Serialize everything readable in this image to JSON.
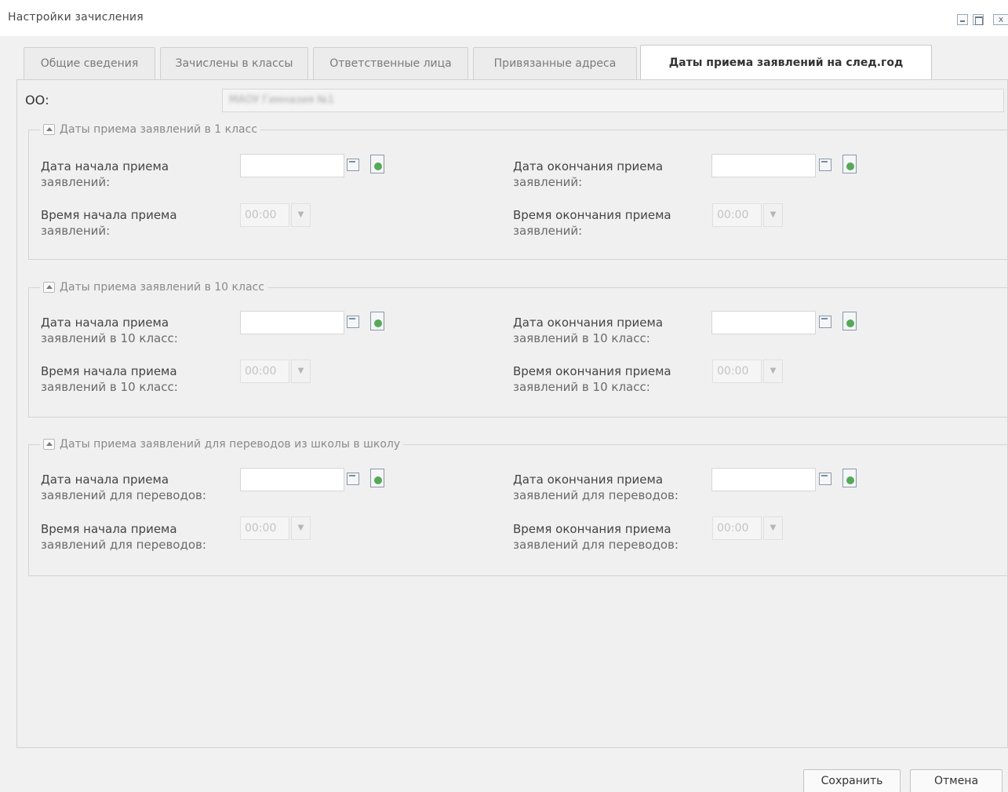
{
  "window": {
    "title": "Настройки зачисления",
    "close_glyph": "x"
  },
  "tabs": [
    {
      "label": "Общие сведения",
      "active": false
    },
    {
      "label": "Зачислены в классы",
      "active": false
    },
    {
      "label": "Ответственные лица",
      "active": false
    },
    {
      "label": "Привязанные адреса",
      "active": false
    },
    {
      "label": "Даты приема заявлений на след.год",
      "active": true
    }
  ],
  "oo": {
    "label": "ОО:",
    "value": "МАОУ Гимназия №1"
  },
  "groups": [
    {
      "legend": "Даты приема заявлений в 1 класс",
      "start_date_label": [
        "Дата начала приема",
        "заявлений:"
      ],
      "end_date_label": [
        "Дата окончания приема",
        "заявлений:"
      ],
      "start_time_label": [
        "Время начала приема",
        "заявлений:"
      ],
      "end_time_label": [
        "Время окончания приема",
        "заявлений:"
      ],
      "start_date": "",
      "end_date": "",
      "start_time": "00:00",
      "end_time": "00:00"
    },
    {
      "legend": "Даты приема заявлений в 10 класс",
      "start_date_label": [
        "Дата начала приема",
        "заявлений в 10 класс:"
      ],
      "end_date_label": [
        "Дата окончания приема",
        "заявлений в 10 класс:"
      ],
      "start_time_label": [
        "Время начала приема",
        "заявлений в 10 класс:"
      ],
      "end_time_label": [
        "Время окончания приема",
        "заявлений в 10 класс:"
      ],
      "start_date": "",
      "end_date": "",
      "start_time": "00:00",
      "end_time": "00:00"
    },
    {
      "legend": "Даты приема заявлений для переводов из школы в школу",
      "start_date_label": [
        "Дата начала приема",
        "заявлений для переводов:"
      ],
      "end_date_label": [
        "Дата окончания приема",
        "заявлений для переводов:"
      ],
      "start_time_label": [
        "Время начала приема",
        "заявлений для переводов:"
      ],
      "end_time_label": [
        "Время окончания приема",
        "заявлений для переводов:"
      ],
      "start_date": "",
      "end_date": "",
      "start_time": "00:00",
      "end_time": "00:00"
    }
  ],
  "footer": {
    "save_label": "Сохранить",
    "cancel_label": "Отмена"
  },
  "icons": {
    "calendar": "calendar-icon",
    "date_clear": "date-select-icon",
    "dropdown": "chevron-down-icon",
    "collapse": "collapse-arrow-icon"
  },
  "glyphs": {
    "dropdown": "▼"
  }
}
